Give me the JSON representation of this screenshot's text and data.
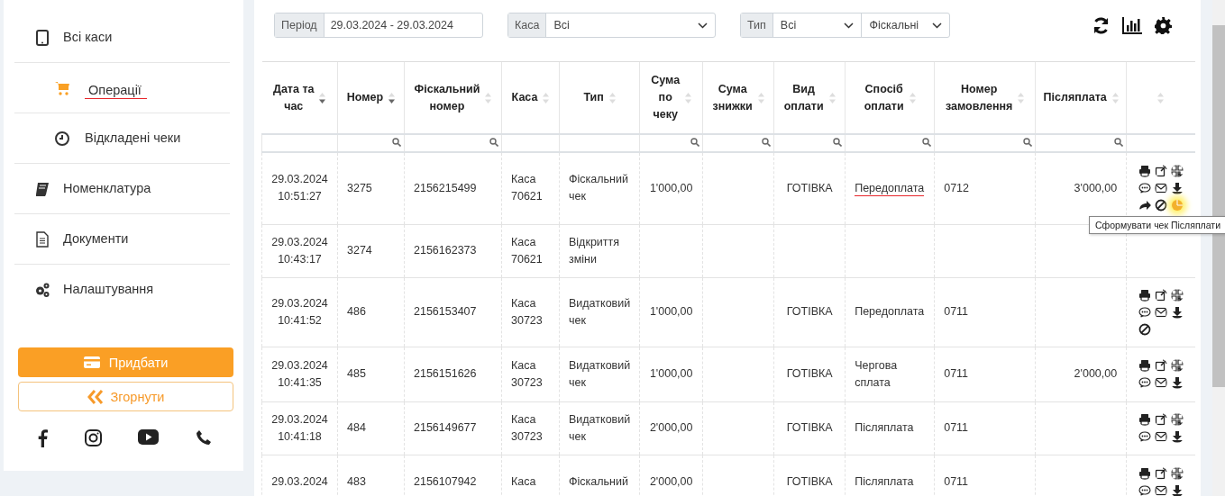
{
  "sidebar": {
    "items": [
      {
        "label": "Всі каси",
        "kind": "tablet",
        "selected": false,
        "annotated": false,
        "children": [
          {
            "label": "Операції",
            "kind": "cart",
            "selected": true,
            "annotated": true
          },
          {
            "label": "Відкладені чеки",
            "kind": "clock",
            "selected": false,
            "annotated": false
          }
        ]
      },
      {
        "label": "Номенклатура",
        "kind": "book",
        "selected": false,
        "annotated": false
      },
      {
        "label": "Документи",
        "kind": "document",
        "selected": false,
        "annotated": false
      },
      {
        "label": "Налаштування",
        "kind": "gears",
        "selected": false,
        "annotated": false
      }
    ],
    "buy_button": "Придбати",
    "collapse_button": "Згорнути"
  },
  "filters": {
    "period": {
      "label": "Період",
      "value": "29.03.2024 - 29.03.2024"
    },
    "kasa": {
      "label": "Каса",
      "value": "Всі"
    },
    "type": {
      "label": "Тип",
      "value": "Всі",
      "value_2": "Фіскальні"
    }
  },
  "table": {
    "columns": [
      {
        "label": "Дата та\nчас",
        "sorted": true,
        "filter": false
      },
      {
        "label": "Номер",
        "sorted": true,
        "filter": true
      },
      {
        "label": "Фіскальний\nномер",
        "sorted": false,
        "filter": true
      },
      {
        "label": "Каса",
        "sorted": false,
        "filter": false
      },
      {
        "label": "Тип",
        "sorted": false,
        "filter": false
      },
      {
        "label": "Сума\nпо\nчеку",
        "sorted": false,
        "filter": true
      },
      {
        "label": "Сума\nзнижки",
        "sorted": false,
        "filter": true
      },
      {
        "label": "Вид\nоплати",
        "sorted": false,
        "filter": true
      },
      {
        "label": "Спосіб\nоплати",
        "sorted": false,
        "filter": true
      },
      {
        "label": "Номер\nзамовлення",
        "sorted": false,
        "filter": true
      },
      {
        "label": "Післяплата",
        "sorted": false,
        "filter": true
      },
      {
        "sorted": false,
        "filter": false
      }
    ],
    "rows": [
      {
        "cells": [
          "29.03.2024\n10:51:27",
          "3275",
          "2156215499",
          "Каса\n70621",
          "Фіскальний\nчек",
          "1'000,00",
          null,
          "ГОТІВКА",
          {
            "text": "Передоплата",
            "annotated": true
          },
          "0712",
          "3'000,00"
        ],
        "actions": [
          {
            "kind": "print",
            "highlighted": false
          },
          {
            "kind": "external",
            "highlighted": false
          },
          {
            "kind": "qr",
            "highlighted": false
          },
          {
            "kind": "comment",
            "highlighted": false
          },
          {
            "kind": "mail",
            "highlighted": false
          },
          {
            "kind": "download",
            "highlighted": false
          },
          {
            "kind": "forward",
            "highlighted": false
          },
          {
            "kind": "cancel",
            "highlighted": false
          },
          {
            "kind": "coin",
            "highlighted": true
          }
        ],
        "tooltip": "Сформувати чек Післяплати"
      },
      {
        "cells": [
          "29.03.2024\n10:43:17",
          "3274",
          "2156162373",
          "Каса\n70621",
          "Відкриття\nзміни",
          null,
          null,
          null,
          null,
          null,
          null
        ],
        "actions": []
      },
      {
        "cells": [
          "29.03.2024\n10:41:52",
          "486",
          "2156153407",
          "Каса\n30723",
          "Видатковий\nчек",
          "1'000,00",
          null,
          "ГОТІВКА",
          "Передоплата",
          "0711",
          null
        ],
        "actions": [
          {
            "kind": "print",
            "highlighted": false
          },
          {
            "kind": "external",
            "highlighted": false
          },
          {
            "kind": "qr",
            "highlighted": false
          },
          {
            "kind": "comment",
            "highlighted": false
          },
          {
            "kind": "mail",
            "highlighted": false
          },
          {
            "kind": "download",
            "highlighted": false
          },
          {
            "kind": "cancel",
            "highlighted": false
          }
        ]
      },
      {
        "cells": [
          "29.03.2024\n10:41:35",
          "485",
          "2156151626",
          "Каса\n30723",
          "Видатковий\nчек",
          "1'000,00",
          null,
          "ГОТІВКА",
          "Чергова\nсплата",
          "0711",
          "2'000,00"
        ],
        "actions": [
          {
            "kind": "print",
            "highlighted": false
          },
          {
            "kind": "external",
            "highlighted": false
          },
          {
            "kind": "qr",
            "highlighted": false
          },
          {
            "kind": "comment",
            "highlighted": false
          },
          {
            "kind": "mail",
            "highlighted": false
          },
          {
            "kind": "download",
            "highlighted": false
          }
        ]
      },
      {
        "cells": [
          "29.03.2024\n10:41:18",
          "484",
          "2156149677",
          "Каса\n30723",
          "Видатковий\nчек",
          "2'000,00",
          null,
          "ГОТІВКА",
          "Післяплата",
          "0711",
          null
        ],
        "actions": [
          {
            "kind": "print",
            "highlighted": false
          },
          {
            "kind": "external",
            "highlighted": false
          },
          {
            "kind": "qr",
            "highlighted": false
          },
          {
            "kind": "comment",
            "highlighted": false
          },
          {
            "kind": "mail",
            "highlighted": false
          },
          {
            "kind": "download",
            "highlighted": false
          }
        ]
      },
      {
        "cells": [
          "29.03.2024",
          "483",
          "2156107942",
          "Каса",
          "Фіскальний",
          "2'000,00",
          null,
          "ГОТІВКА",
          "Післяплата",
          "0711",
          null
        ],
        "actions": [
          {
            "kind": "print",
            "highlighted": false
          },
          {
            "kind": "external",
            "highlighted": false
          },
          {
            "kind": "qr",
            "highlighted": false
          },
          {
            "kind": "comment",
            "highlighted": false
          },
          {
            "kind": "mail",
            "highlighted": false
          },
          {
            "kind": "download",
            "highlighted": false
          }
        ]
      }
    ]
  }
}
